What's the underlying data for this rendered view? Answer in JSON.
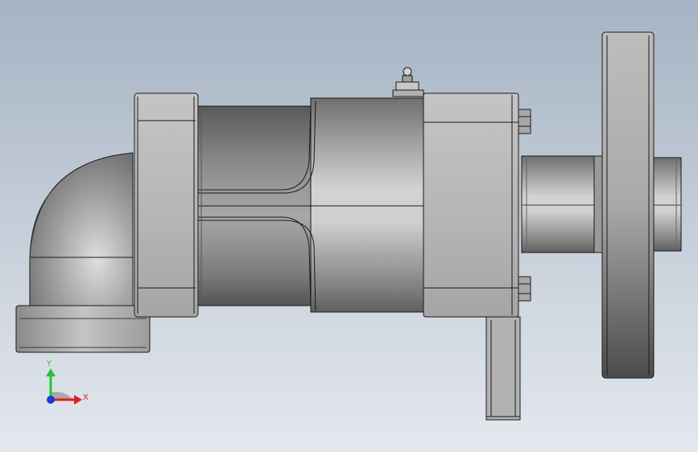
{
  "viewport": {
    "background_top": "#a6b3c4",
    "background_bottom": "#e4e8ee"
  },
  "triad": {
    "y_label": "Y",
    "x_label": "X",
    "y_color": "#22c43a",
    "x_color": "#e02020",
    "z_color": "#1a3ad8"
  },
  "model": {
    "body_color": "#bdbdbd",
    "edge_color": "#1a1a1a"
  }
}
